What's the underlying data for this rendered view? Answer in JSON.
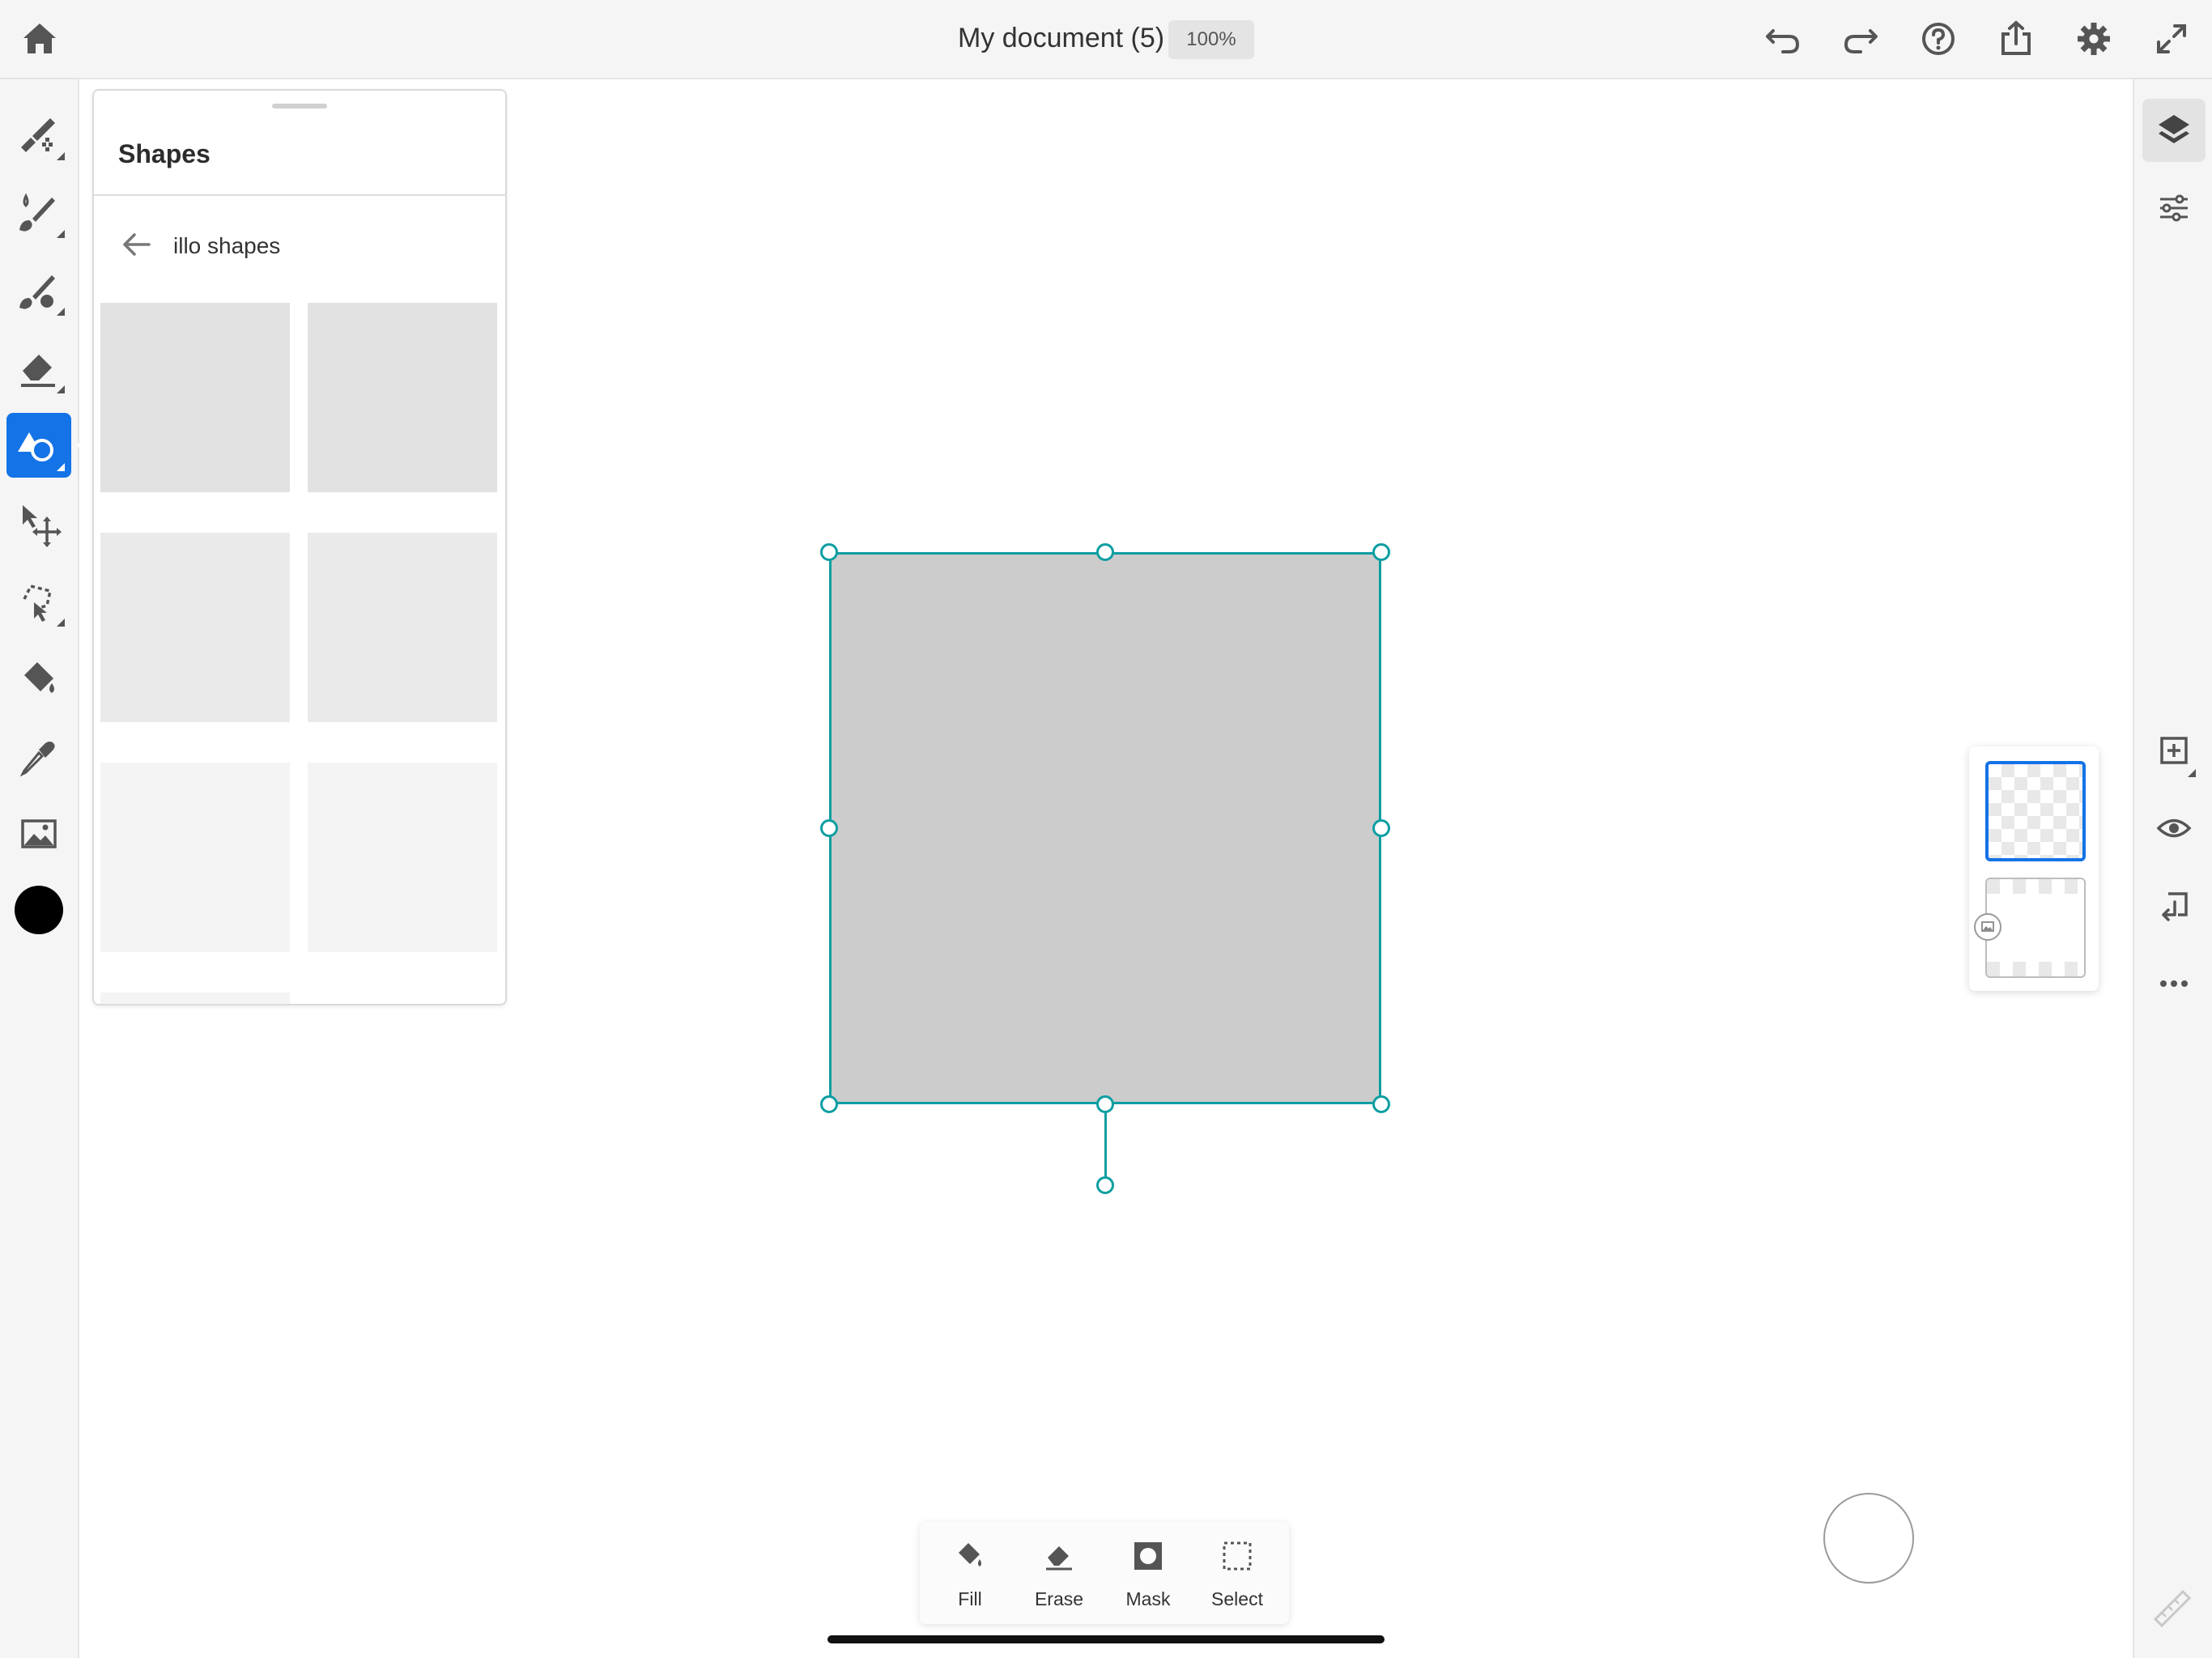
{
  "header": {
    "title": "My document (5)",
    "zoom": "100%",
    "icons": [
      "home-icon",
      "undo-icon",
      "redo-icon",
      "help-icon",
      "share-icon",
      "settings-icon",
      "fullscreen-icon"
    ]
  },
  "left_toolbar": {
    "tools": [
      "pixel-brush-icon",
      "live-brush-icon",
      "vector-brush-icon",
      "eraser-icon",
      "shapes-icon",
      "transform-icon",
      "lasso-select-icon",
      "fill-icon",
      "eyedropper-icon",
      "image-icon"
    ],
    "active_tool": "shapes-icon",
    "color": "#000000"
  },
  "shapes_panel": {
    "title": "Shapes",
    "folder": "illo shapes"
  },
  "right_panel": {
    "icons": [
      "layers-icon",
      "layer-properties-icon",
      "add-layer-icon",
      "visibility-icon",
      "merge-down-icon",
      "more-icon"
    ]
  },
  "action_bar": {
    "fill": "Fill",
    "erase": "Erase",
    "mask": "Mask",
    "select": "Select"
  },
  "colors": {
    "accent": "#1473e6",
    "selection": "#0d9ea1",
    "shape_fill": "#cccccc"
  }
}
